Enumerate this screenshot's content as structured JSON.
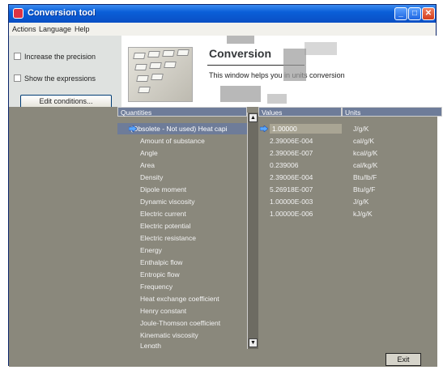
{
  "window": {
    "title": "Conversion tool"
  },
  "menubar": {
    "items": [
      "Actions",
      "Language",
      "Help"
    ]
  },
  "options": {
    "increase_precision": "Increase the precision",
    "show_expressions": "Show the expressions",
    "edit_conditions": "Edit conditions..."
  },
  "header": {
    "title": "Conversion",
    "subtitle": "This window helps you in units conversion"
  },
  "table": {
    "quantities_header": "Quantities",
    "values_header": "Values",
    "units_header": "Units",
    "quantities": [
      "(Obsolete - Not used) Heat capi",
      "Amount of substance",
      "Angle",
      "Area",
      "Density",
      "Dipole moment",
      "Dynamic viscosity",
      "Electric current",
      "Electric potential",
      "Electric resistance",
      "Energy",
      "Enthalpic flow",
      "Entropic flow",
      "Frequency",
      "Heat exchange coefficient",
      "Henry constant",
      "Joule-Thomson coefficient",
      "Kinematic viscosity",
      "Length"
    ],
    "values": [
      "1.00000",
      "2.39006E-004",
      "2.39006E-007",
      "0.239006",
      "2.39006E-004",
      "5.26918E-007",
      "1.00000E-003",
      "1.00000E-006"
    ],
    "units": [
      "J/g/K",
      "cal/g/K",
      "kcal/g/K",
      "cal/kg/K",
      "Btu/lb/F",
      "Btu/g/F",
      "J/g/K",
      "kJ/g/K"
    ]
  },
  "footer": {
    "exit_label": "Exit"
  },
  "colors": {
    "titlebar": "#0a5fd8",
    "selection": "#6e7c99",
    "grid_bg": "#8a887c"
  }
}
